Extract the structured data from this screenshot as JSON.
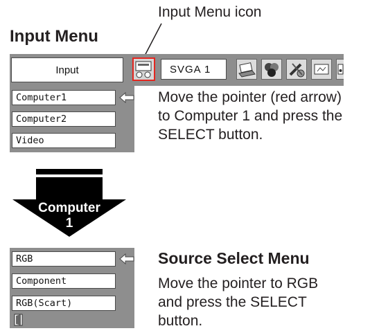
{
  "callout": {
    "icon_caption": "Input Menu icon"
  },
  "input_menu": {
    "title": "Input Menu",
    "input_label": "Input",
    "resolution": "SVGA 1",
    "toolbar_icons": [
      "laptop-icon",
      "color-balls-icon",
      "tools-icon",
      "screen-icon",
      "speaker-icon"
    ],
    "items": [
      "Computer1",
      "Computer2",
      "Video"
    ],
    "pointer_on": "Computer1"
  },
  "instruction_1": {
    "lines": [
      "Move the pointer (red arrow)",
      "to Computer 1 and press the",
      "SELECT button."
    ]
  },
  "step_arrow": {
    "line1": "Computer",
    "line2": "1"
  },
  "source_select": {
    "title": "Source Select Menu",
    "items": [
      "RGB",
      "Component",
      "RGB(Scart)"
    ],
    "pointer_on": "RGB",
    "exit_icon": "exit-door-icon"
  },
  "instruction_2": {
    "lines": [
      "Move the pointer to RGB",
      "and press the SELECT",
      "button."
    ]
  },
  "colors": {
    "panel": "#8e8e8e",
    "pointer": "#e5261f",
    "arrow": "#000000"
  }
}
